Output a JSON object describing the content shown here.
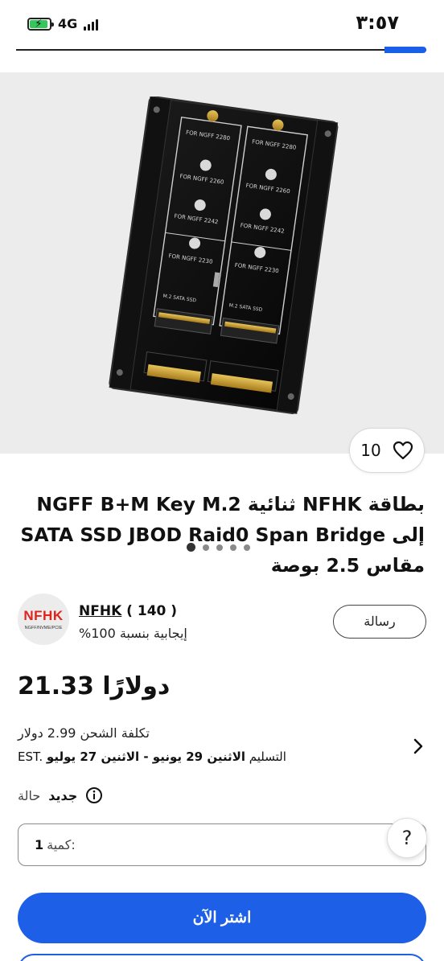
{
  "status_bar": {
    "time": "٣:٥٧",
    "network": "4G"
  },
  "gallery": {
    "image_alt": "M.2 NGFF to SATA dual adapter board",
    "board_labels": [
      "FOR NGFF 2280",
      "FOR NGFF 2280",
      "FOR NGFF 2260",
      "FOR NGFF 2260",
      "FOR NGFF 2242",
      "FOR NGFF 2242",
      "FOR NGFF 2230",
      "FOR NGFF 2230",
      "M.2 SATA SSD",
      "M.2 SATA SSD"
    ],
    "like_count": "10",
    "page_count": 5,
    "active_page": 1
  },
  "product": {
    "title": "بطاقة NFHK ثنائية NGFF B+M Key M.2 إلى SATA SSD JBOD Raid0 Span Bridge مقاس 2.5 بوصة"
  },
  "seller": {
    "logo_text": "NFHK",
    "logo_sub": "NGFF/NVME/PCIE",
    "name": "NFHK",
    "rating_count": "( 140 )",
    "feedback": "%100 إيجابية بنسبة",
    "message_label": "رسالة"
  },
  "pricing": {
    "price": "21.33 دولارًا",
    "shipping": "تكلفة الشحن 2.99 دولار",
    "delivery_dates": "الاثنين 29 يونيو - الاثنين 27 يوليو",
    "delivery_label": "EST. التسليم"
  },
  "condition": {
    "label": "حالة",
    "value": "جديد"
  },
  "quantity": {
    "label": "كمية:",
    "value": "1"
  },
  "actions": {
    "buy_now": "اشتر الآن",
    "help": "?"
  },
  "colors": {
    "accent": "#1d5fe6",
    "brand_red": "#e0231b"
  }
}
